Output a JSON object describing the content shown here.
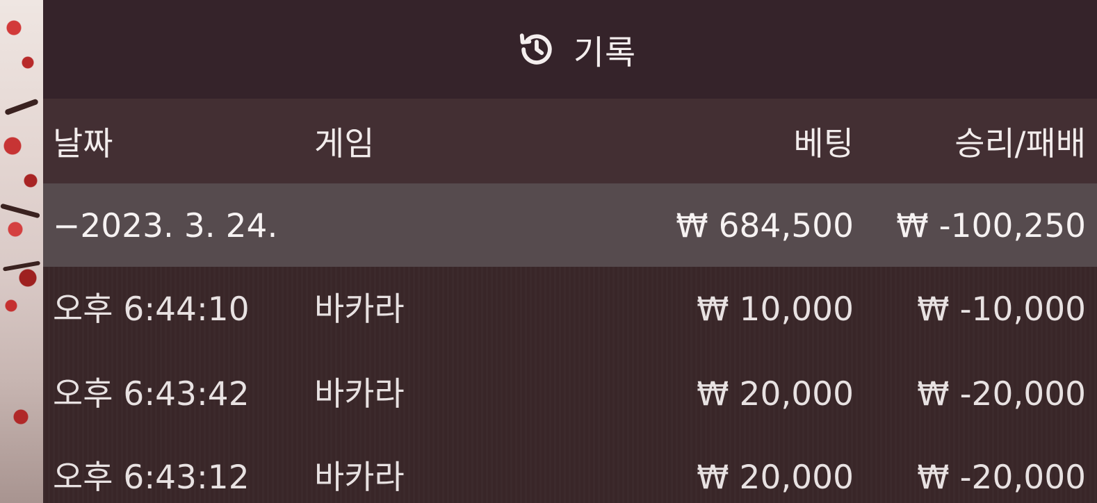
{
  "header": {
    "title": "기록",
    "icon": "history-icon"
  },
  "columns": {
    "date": "날짜",
    "game": "게임",
    "bet": "베팅",
    "win_loss": "승리/패배"
  },
  "summary": {
    "date": "−2023. 3. 24.",
    "bet": "₩ 684,500",
    "win_loss": "₩ -100,250"
  },
  "rows": [
    {
      "time": "오후 6:44:10",
      "game": "바카라",
      "bet": "₩ 10,000",
      "win_loss": "₩ -10,000"
    },
    {
      "time": "오후 6:43:42",
      "game": "바카라",
      "bet": "₩ 20,000",
      "win_loss": "₩ -20,000"
    },
    {
      "time": "오후 6:43:12",
      "game": "바카라",
      "bet": "₩ 20,000",
      "win_loss": "₩ -20,000"
    }
  ],
  "colors": {
    "panel_bg": "#3a2729",
    "title_bg": "#35232a",
    "header_bg": "#432f33",
    "summary_bg": "#564b4e",
    "text": "#f2ecec"
  }
}
